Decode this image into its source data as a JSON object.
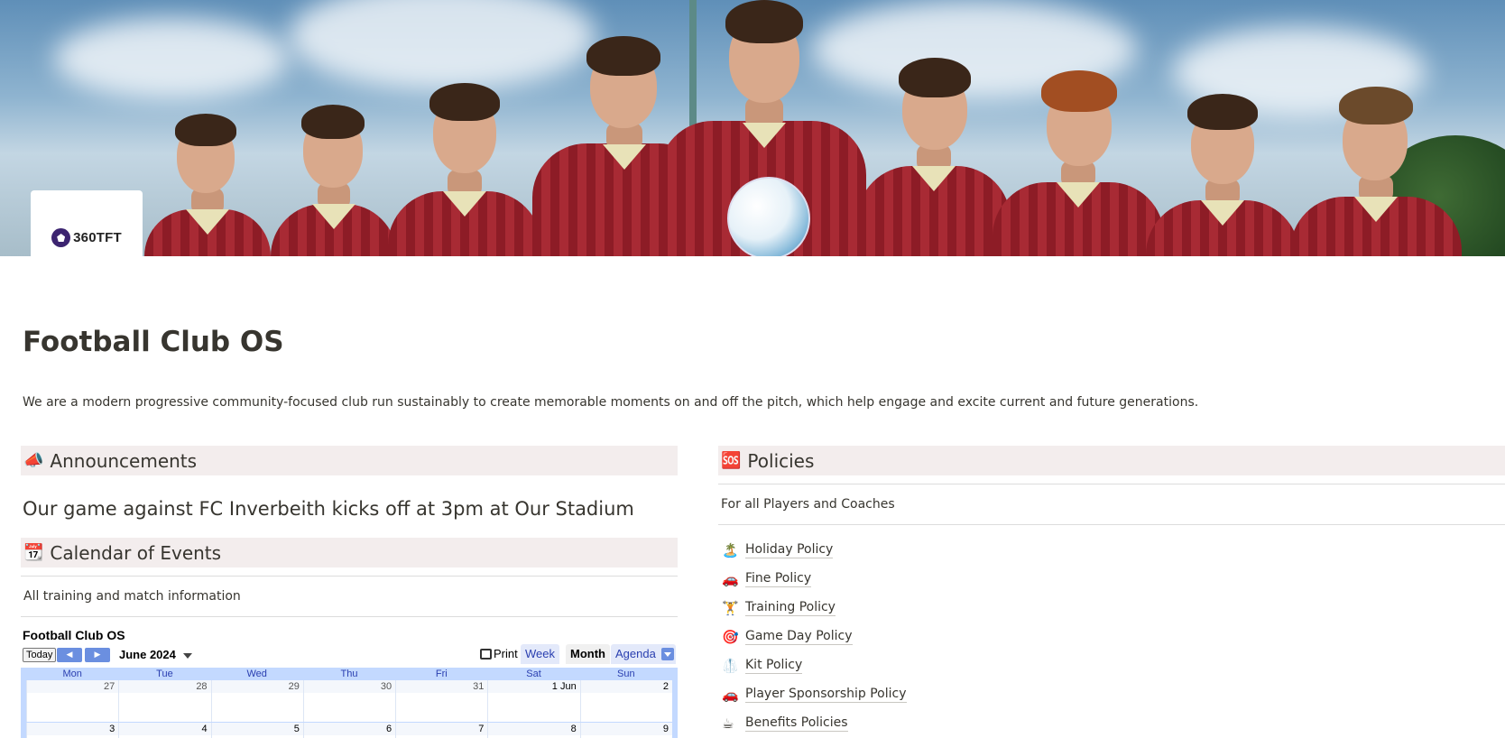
{
  "cover": {
    "logo_text": "360TFT"
  },
  "page": {
    "title": "Football Club OS",
    "description": "We are a modern progressive community-focused club run sustainably to create memorable moments on and off the pitch, which help engage and excite current and future generations."
  },
  "announcements": {
    "icon": "megaphone-icon",
    "glyph": "📣",
    "heading": "Announcements",
    "text": "Our game against FC Inverbeith kicks off at 3pm at Our Stadium"
  },
  "calendar_section": {
    "icon": "calendar-icon",
    "glyph": "📆",
    "heading": "Calendar of Events",
    "subtitle": "All training and match information"
  },
  "calendar": {
    "title": "Football Club OS",
    "today_label": "Today",
    "prev_glyph": "◀",
    "next_glyph": "▶",
    "month_label": "June 2024",
    "print_label": "Print",
    "views": [
      "Week",
      "Month",
      "Agenda"
    ],
    "active_view": "Month",
    "weekdays": [
      "Mon",
      "Tue",
      "Wed",
      "Thu",
      "Fri",
      "Sat",
      "Sun"
    ],
    "weeks": [
      [
        "27",
        "28",
        "29",
        "30",
        "31",
        "1 Jun",
        "2"
      ],
      [
        "3",
        "4",
        "5",
        "6",
        "7",
        "8",
        "9"
      ]
    ]
  },
  "policies": {
    "icon": "sos-icon",
    "glyph": "🆘",
    "heading": "Policies",
    "subtitle": "For all Players and Coaches",
    "items": [
      {
        "glyph": "🏝️",
        "icon": "beach-umbrella-icon",
        "label": "Holiday Policy"
      },
      {
        "glyph": "🚗",
        "icon": "car-icon",
        "label": "Fine Policy"
      },
      {
        "glyph": "🏋️",
        "icon": "weightlifter-icon",
        "label": "Training Policy"
      },
      {
        "glyph": "🎯",
        "icon": "target-icon",
        "label": "Game Day Policy"
      },
      {
        "glyph": "🥼",
        "icon": "kit-icon",
        "label": "Kit Policy"
      },
      {
        "glyph": "🚗",
        "icon": "car-icon",
        "label": "Player Sponsorship Policy"
      },
      {
        "glyph": "☕",
        "icon": "coffee-icon",
        "label": "Benefits Policies"
      }
    ]
  },
  "colors": {
    "callout_bg": "#f3eded",
    "calendar_border": "#c3d9ff",
    "calendar_button": "#6b8fe0",
    "shirt_red": "#8d1c26"
  }
}
